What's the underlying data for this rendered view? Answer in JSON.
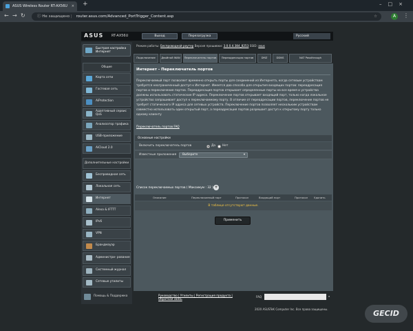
{
  "browser": {
    "tab_title": "ASUS Wireless Router RT-AX56U",
    "security_label": "Не защищено",
    "url": "router.asus.com/Advanced_PortTrigger_Content.asp",
    "avatar_letter": "A"
  },
  "header": {
    "logo": "ASUS",
    "model": "RT-AX56U",
    "logout_label": "Выход",
    "reboot_label": "Перезагрузка",
    "language": "Русский"
  },
  "status": {
    "mode_label": "Режим работы:",
    "mode_value": "Беспроводной роутер",
    "firmware_label": "Версия прошивки:",
    "firmware_value": "3.0.0.4.384_8253",
    "ssid_label": "SSID:",
    "ssid_value": "asus"
  },
  "sidebar": {
    "quick_setup": "Быстрая настройка Интернет",
    "general_header": "Общие",
    "general_items": [
      {
        "label": "Карта сети",
        "color": "#5aa7d8"
      },
      {
        "label": "Гостевая сеть",
        "color": "#7fb7d6"
      },
      {
        "label": "AiProtection",
        "color": "#4c8fc2"
      },
      {
        "label": "Адаптивный сервис QoS",
        "color": "#8ab4c9"
      },
      {
        "label": "Анализатор трафика",
        "color": "#7aa6bd"
      },
      {
        "label": "USB-приложение",
        "color": "#9bb8c6"
      },
      {
        "label": "AiCloud 2.0",
        "color": "#6aa1c8"
      }
    ],
    "advanced_header": "Дополнительные настройки",
    "advanced_items": [
      {
        "label": "Беспроводная сеть",
        "color": "#9fc3d6"
      },
      {
        "label": "Локальная сеть",
        "color": "#b0c6d2"
      },
      {
        "label": "Интернет",
        "color": "#d6e4ea"
      },
      {
        "label": "Alexa & IFTTT",
        "color": "#8fb0c0"
      },
      {
        "label": "IPv6",
        "color": "#a8c0cc"
      },
      {
        "label": "VPN",
        "color": "#9ab6c4"
      },
      {
        "label": "Брандмауэр",
        "color": "#c28a4c"
      },
      {
        "label": "Администри- рование",
        "color": "#a9bcc6"
      },
      {
        "label": "Системный журнал",
        "color": "#9eb4bf"
      },
      {
        "label": "Сетевые утилиты",
        "color": "#a3bac5"
      }
    ],
    "help_label": "Помощь & Поддержка"
  },
  "tabs": [
    {
      "label": "Подключение"
    },
    {
      "label": "Двойной WAN"
    },
    {
      "label": "Переключатель портов"
    },
    {
      "label": "Переадресация портов"
    },
    {
      "label": "DMZ"
    },
    {
      "label": "DDNS"
    },
    {
      "label": "NAT Passthrough"
    }
  ],
  "main": {
    "title": "Интернет - Переключатель портов",
    "description": "Переключаемый порт позволяет временно открыть порты для соединений из Интернета, когда сетевым устройствам требуется неограниченный доступ к Интернет. Имеется два способа для открытия входящих портов: переадресация портов и переключение портов. Переадресация портов открывает определенные порты на все время и устройства должны использовать статические IP адреса. Переключение портов открывает входящий порт, только когда локальное устройство запрашивает доступ к переключаемому порту. В отличие от переадресации портов, переключение портов не требует статического IP адреса для сетевых устройств. Переключение портов позволяет нескольким устройствам совместно использовать один открытый порт, а переадресация портов разрешает доступ к открытому порту только одному клиенту",
    "faq_link": "Переключатель портов FAQ",
    "basic_header": "Основные настройки",
    "enable_label": "Включить переключатель портов",
    "yes_label": "Да",
    "no_label": "Нет",
    "apps_label": "Известные приложения",
    "apps_select": "Выберите",
    "list_label": "Список переключаемых портов ( Максимум : 32 )",
    "columns": [
      "Описание",
      "Переключаемый порт",
      "Протокол",
      "Входящий порт",
      "Протокол",
      "Удалить"
    ],
    "empty_text": "В таблице отсутствуют данные.",
    "apply_label": "Применить"
  },
  "footer": {
    "help_label": "Помощь & Поддержка",
    "links_text": "Руководство | Утилиты | Регистрация продукта | Обратная связь",
    "faq_label": "FAQ",
    "copyright": "2020 ASUSTeK Computer Inc. Все права защищены.",
    "watermark": "GECID"
  }
}
